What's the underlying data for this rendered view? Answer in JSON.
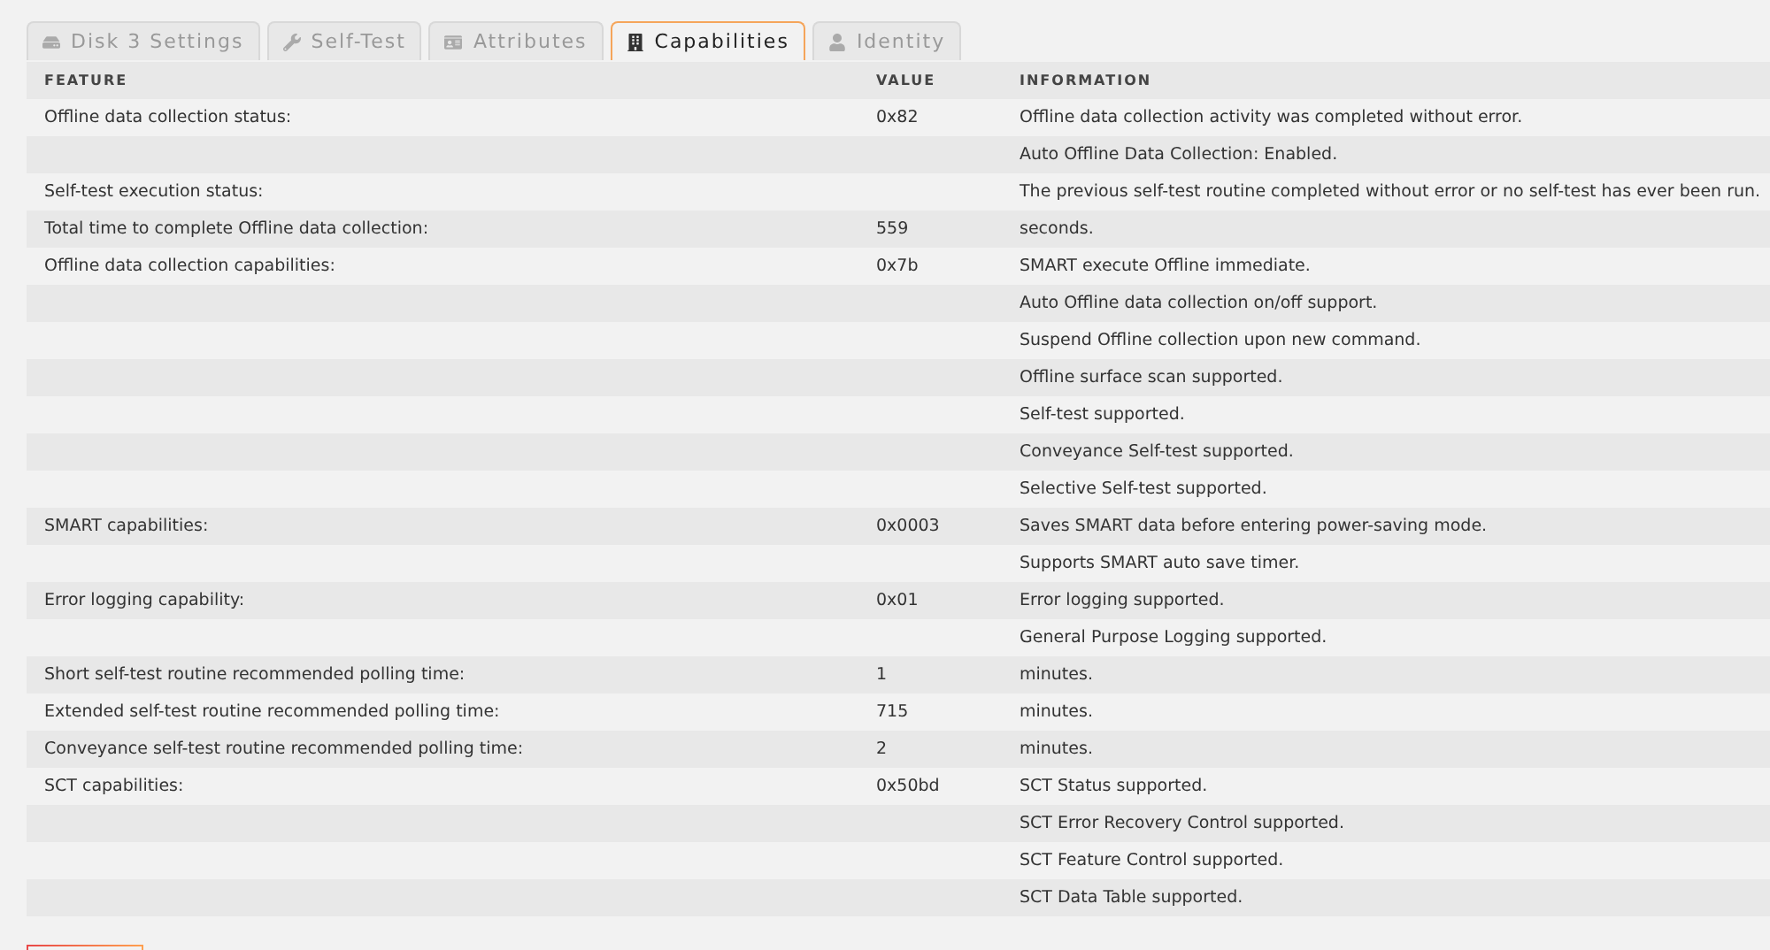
{
  "tabs": [
    {
      "label": "Disk 3 Settings",
      "selected": false
    },
    {
      "label": "Self-Test",
      "selected": false
    },
    {
      "label": "Attributes",
      "selected": false
    },
    {
      "label": "Capabilities",
      "selected": true
    },
    {
      "label": "Identity",
      "selected": false
    }
  ],
  "table": {
    "columns": [
      "FEATURE",
      "VALUE",
      "INFORMATION"
    ],
    "rows": [
      {
        "feature": "Offline data collection status:",
        "value": "0x82",
        "information": "Offline data collection activity was completed without error."
      },
      {
        "information": "Auto Offline Data Collection: Enabled."
      },
      {
        "feature": "Self-test execution status:",
        "information": "The previous self-test routine completed without error or no self-test has ever been run."
      },
      {
        "feature": "Total time to complete Offline data collection:",
        "value": "559",
        "information": "seconds."
      },
      {
        "feature": "Offline data collection capabilities:",
        "value": "0x7b",
        "information": "SMART execute Offline immediate."
      },
      {
        "information": "Auto Offline data collection on/off support."
      },
      {
        "information": "Suspend Offline collection upon new command."
      },
      {
        "information": "Offline surface scan supported."
      },
      {
        "information": "Self-test supported."
      },
      {
        "information": "Conveyance Self-test supported."
      },
      {
        "information": "Selective Self-test supported."
      },
      {
        "feature": "SMART capabilities:",
        "value": "0x0003",
        "information": "Saves SMART data before entering power-saving mode."
      },
      {
        "information": "Supports SMART auto save timer."
      },
      {
        "feature": "Error logging capability:",
        "value": "0x01",
        "information": "Error logging supported."
      },
      {
        "information": "General Purpose Logging supported."
      },
      {
        "feature": "Short self-test routine recommended polling time:",
        "value": "1",
        "information": "minutes."
      },
      {
        "feature": "Extended self-test routine recommended polling time:",
        "value": "715",
        "information": "minutes."
      },
      {
        "feature": "Conveyance self-test routine recommended polling time:",
        "value": "2",
        "information": "minutes."
      },
      {
        "feature": "SCT capabilities:",
        "value": "0x50bd",
        "information": "SCT Status supported."
      },
      {
        "information": "SCT Error Recovery Control supported."
      },
      {
        "information": "SCT Feature Control supported."
      },
      {
        "information": "SCT Data Table supported."
      }
    ]
  }
}
